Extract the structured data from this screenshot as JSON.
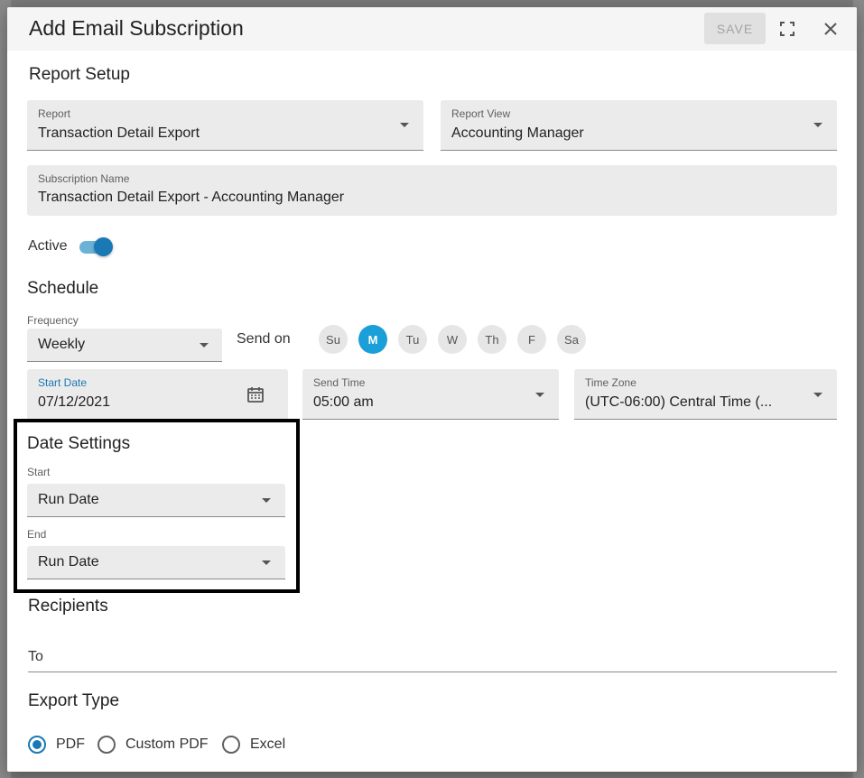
{
  "dialog": {
    "title": "Add Email Subscription",
    "save_label": "SAVE",
    "fullscreen_icon": "fullscreen-icon",
    "close_icon": "close-icon"
  },
  "report_setup": {
    "title": "Report Setup",
    "report": {
      "label": "Report",
      "value": "Transaction Detail Export"
    },
    "report_view": {
      "label": "Report View",
      "value": "Accounting Manager"
    },
    "subscription_name": {
      "label": "Subscription Name",
      "value": "Transaction Detail Export - Accounting Manager"
    },
    "active": {
      "label": "Active",
      "on": true
    }
  },
  "schedule": {
    "title": "Schedule",
    "frequency": {
      "label": "Frequency",
      "value": "Weekly"
    },
    "send_on": {
      "label": "Send on",
      "days": [
        {
          "label": "Su",
          "selected": false
        },
        {
          "label": "M",
          "selected": true
        },
        {
          "label": "Tu",
          "selected": false
        },
        {
          "label": "W",
          "selected": false
        },
        {
          "label": "Th",
          "selected": false
        },
        {
          "label": "F",
          "selected": false
        },
        {
          "label": "Sa",
          "selected": false
        }
      ]
    },
    "start_date": {
      "label": "Start Date",
      "value": "07/12/2021",
      "icon": "calendar-icon"
    },
    "send_time": {
      "label": "Send Time",
      "value": "05:00 am"
    },
    "time_zone": {
      "label": "Time Zone",
      "value": "(UTC-06:00) Central Time (..."
    }
  },
  "date_settings": {
    "title": "Date Settings",
    "start": {
      "label": "Start",
      "value": "Run Date"
    },
    "end": {
      "label": "End",
      "value": "Run Date"
    }
  },
  "recipients": {
    "title": "Recipients",
    "to_label": "To"
  },
  "export_type": {
    "title": "Export Type",
    "options": [
      {
        "label": "PDF",
        "checked": true
      },
      {
        "label": "Custom PDF",
        "checked": false
      },
      {
        "label": "Excel",
        "checked": false
      }
    ]
  },
  "colors": {
    "accent": "#1a79b4",
    "chip_selected": "#1a9fd8",
    "field_bg": "#ebebeb",
    "start_date_label": "#1a79b4"
  }
}
